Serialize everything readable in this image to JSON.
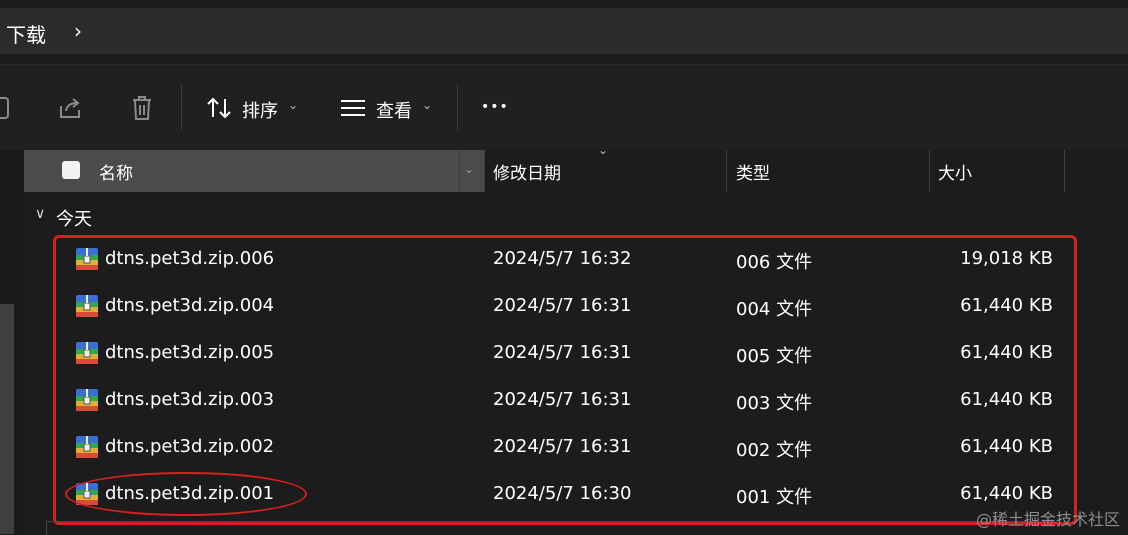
{
  "address": {
    "breadcrumb": "下载",
    "chevron": "›"
  },
  "toolbar": {
    "sort_label": "排序",
    "view_label": "查看",
    "more_label": "•••",
    "chevron": "⌄"
  },
  "columns": {
    "name": "名称",
    "date": "修改日期",
    "type": "类型",
    "size": "大小"
  },
  "group": {
    "label": "今天",
    "chevron": "∨"
  },
  "files": [
    {
      "name": "dtns.pet3d.zip.006",
      "date": "2024/5/7 16:32",
      "type": "006 文件",
      "size": "19,018 KB"
    },
    {
      "name": "dtns.pet3d.zip.004",
      "date": "2024/5/7 16:31",
      "type": "004 文件",
      "size": "61,440 KB"
    },
    {
      "name": "dtns.pet3d.zip.005",
      "date": "2024/5/7 16:31",
      "type": "005 文件",
      "size": "61,440 KB"
    },
    {
      "name": "dtns.pet3d.zip.003",
      "date": "2024/5/7 16:31",
      "type": "003 文件",
      "size": "61,440 KB"
    },
    {
      "name": "dtns.pet3d.zip.002",
      "date": "2024/5/7 16:31",
      "type": "002 文件",
      "size": "61,440 KB"
    },
    {
      "name": "dtns.pet3d.zip.001",
      "date": "2024/5/7 16:30",
      "type": "001 文件",
      "size": "61,440 KB"
    }
  ],
  "icons": {
    "share": "share-icon",
    "delete": "trash-icon",
    "sort": "sort-arrows-icon",
    "view": "view-lines-icon",
    "file": "zip-archive-icon"
  },
  "colors": {
    "annotation": "#d52020",
    "background": "#1c1c1c",
    "header_selected": "#4b4b4b"
  },
  "watermark": "@稀土掘金技术社区"
}
